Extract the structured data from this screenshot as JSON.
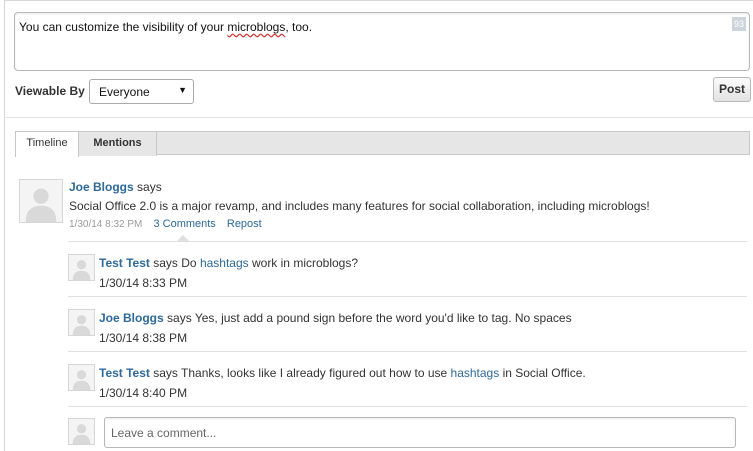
{
  "composer": {
    "text_before": "You can customize the visibility of your ",
    "text_misspelled": "microblogs",
    "text_after": ", too.",
    "char_count": "93"
  },
  "visibility": {
    "label": "Viewable By",
    "selected": "Everyone"
  },
  "post_button": "Post",
  "tabs": [
    {
      "label": "Timeline",
      "active": true
    },
    {
      "label": "Mentions",
      "active": false
    }
  ],
  "entry": {
    "author": "Joe Bloggs",
    "verb": "says",
    "message": "Social Office 2.0 is a major revamp, and includes many features for social collaboration, including microblogs!",
    "timestamp": "1/30/14 8:32 PM",
    "comments_link": "3 Comments",
    "repost_link": "Repost"
  },
  "comments": [
    {
      "author": "Test Test",
      "pre": "says Do ",
      "link": "hashtags",
      "post": " work in microblogs?",
      "timestamp": "1/30/14 8:33 PM"
    },
    {
      "author": "Joe Bloggs",
      "pre": "says Yes, just add a pound sign before the word you'd like to tag. No spaces",
      "link": "",
      "post": "",
      "timestamp": "1/30/14 8:38 PM"
    },
    {
      "author": "Test Test",
      "pre": "says Thanks, looks like I already figured out how to use ",
      "link": "hashtags",
      "post": " in Social Office.",
      "timestamp": "1/30/14 8:40 PM"
    }
  ],
  "comment_input": {
    "placeholder": "Leave a comment..."
  },
  "icons": {
    "avatar": "default-user-avatar-icon",
    "select_arrow": "caret-down-icon"
  }
}
